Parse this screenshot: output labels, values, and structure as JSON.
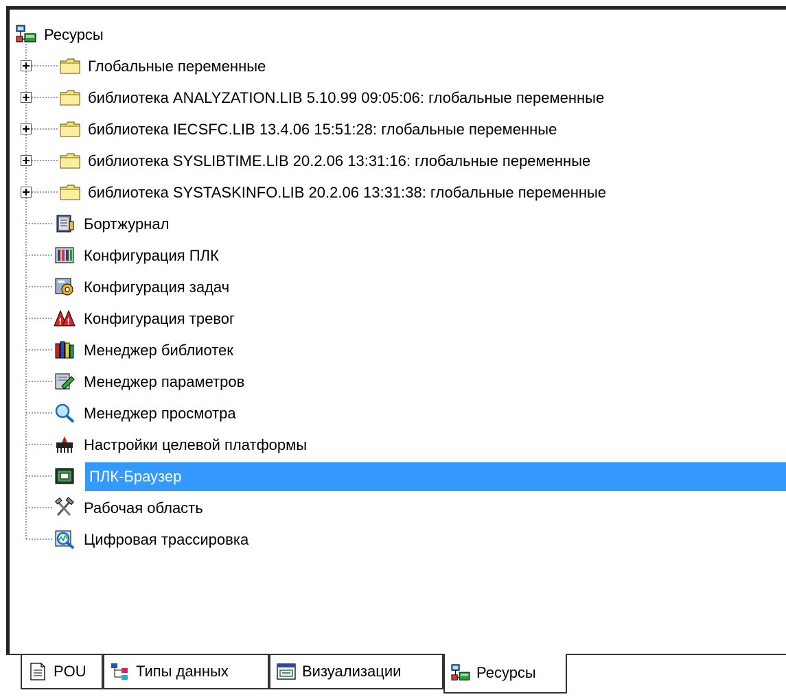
{
  "tree": {
    "root": {
      "label": "Ресурсы",
      "icon": "resources-icon"
    },
    "items": [
      {
        "label": "Глобальные переменные",
        "icon": "folder-icon",
        "expandable": true
      },
      {
        "label": "библиотека ANALYZATION.LIB 5.10.99 09:05:06: глобальные переменные",
        "icon": "folder-icon",
        "expandable": true
      },
      {
        "label": "библиотека IECSFC.LIB 13.4.06 15:51:28: глобальные переменные",
        "icon": "folder-icon",
        "expandable": true
      },
      {
        "label": "библиотека SYSLIBTIME.LIB 20.2.06 13:31:16: глобальные переменные",
        "icon": "folder-icon",
        "expandable": true
      },
      {
        "label": "библиотека SYSTASKINFO.LIB 20.2.06 13:31:38: глобальные переменные",
        "icon": "folder-icon",
        "expandable": true
      },
      {
        "label": "Бортжурнал",
        "icon": "logbook-icon",
        "expandable": false
      },
      {
        "label": "Конфигурация ПЛК",
        "icon": "plc-configuration-icon",
        "expandable": false
      },
      {
        "label": "Конфигурация задач",
        "icon": "task-configuration-icon",
        "expandable": false
      },
      {
        "label": "Конфигурация тревог",
        "icon": "alarm-configuration-icon",
        "expandable": false
      },
      {
        "label": "Менеджер библиотек",
        "icon": "library-manager-icon",
        "expandable": false
      },
      {
        "label": "Менеджер параметров",
        "icon": "parameter-manager-icon",
        "expandable": false
      },
      {
        "label": "Менеджер просмотра",
        "icon": "watch-manager-icon",
        "expandable": false
      },
      {
        "label": "Настройки целевой платформы",
        "icon": "target-settings-icon",
        "expandable": false
      },
      {
        "label": "ПЛК-Браузер",
        "icon": "plc-browser-icon",
        "expandable": false,
        "selected": true
      },
      {
        "label": "Рабочая область",
        "icon": "workspace-icon",
        "expandable": false
      },
      {
        "label": "Цифровая трассировка",
        "icon": "sampling-trace-icon",
        "expandable": false
      }
    ]
  },
  "tabs": [
    {
      "label": "POU",
      "icon": "pou-icon",
      "active": false
    },
    {
      "label": "Типы данных",
      "icon": "data-types-icon",
      "active": false
    },
    {
      "label": "Визуализации",
      "icon": "visualizations-icon",
      "active": false
    },
    {
      "label": "Ресурсы",
      "icon": "resources-icon",
      "active": true
    }
  ],
  "colors": {
    "selection": "#3399ff",
    "folder": "#f5e27a"
  }
}
